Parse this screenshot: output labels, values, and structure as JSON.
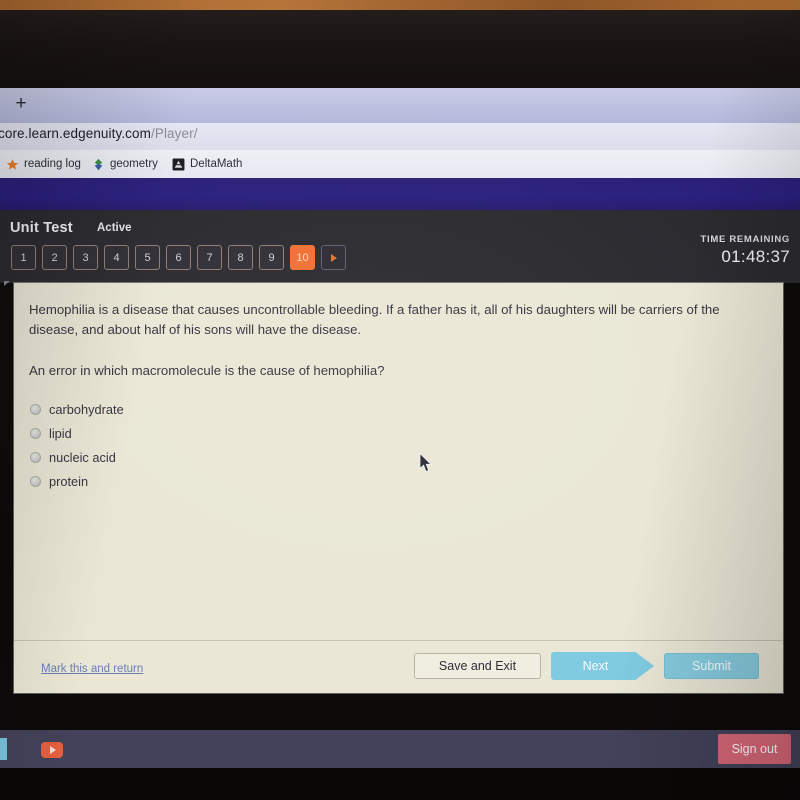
{
  "browser": {
    "new_tab_label": "+",
    "url_host": "core.learn.edgenuity.com",
    "url_path": "/Player/",
    "bookmarks": [
      {
        "label": "reading log",
        "icon": "star-icon"
      },
      {
        "label": "geometry",
        "icon": "diamond-icon"
      },
      {
        "label": "DeltaMath",
        "icon": "deltamath-favicon"
      }
    ]
  },
  "app": {
    "title": "Unit Test",
    "status": "Active",
    "question_nav": [
      {
        "label": "1",
        "active": false
      },
      {
        "label": "2",
        "active": false
      },
      {
        "label": "3",
        "active": false
      },
      {
        "label": "4",
        "active": false
      },
      {
        "label": "5",
        "active": false
      },
      {
        "label": "6",
        "active": false
      },
      {
        "label": "7",
        "active": false
      },
      {
        "label": "8",
        "active": false
      },
      {
        "label": "9",
        "active": false
      },
      {
        "label": "10",
        "active": true
      }
    ],
    "nav_next_icon": "play-arrow-icon",
    "timer": {
      "label": "TIME REMAINING",
      "value": "01:48:37"
    }
  },
  "question": {
    "passage": "Hemophilia is a disease that causes uncontrollable bleeding. If a father has it, all of his daughters will be carriers of the disease, and about half of his sons will have the disease.",
    "prompt": "An error in which macromolecule is the cause of hemophilia?",
    "options": [
      {
        "label": "carbohydrate",
        "selected": false
      },
      {
        "label": "lipid",
        "selected": false
      },
      {
        "label": "nucleic acid",
        "selected": false
      },
      {
        "label": "protein",
        "selected": false
      }
    ]
  },
  "footer": {
    "mark_and_return": "Mark this and return",
    "save_and_exit": "Save and Exit",
    "next": "Next",
    "submit": "Submit"
  },
  "bottom_bar": {
    "play_icon": "play-button-icon",
    "sign_out": "Sign out"
  },
  "colors": {
    "accent_orange": "#ef7032",
    "header_dark": "#2a2a2f",
    "band_indigo": "#2a2080",
    "card_cream": "#eae7d6",
    "action_blue": "#80cbe0",
    "signout_red": "#d9697a"
  }
}
